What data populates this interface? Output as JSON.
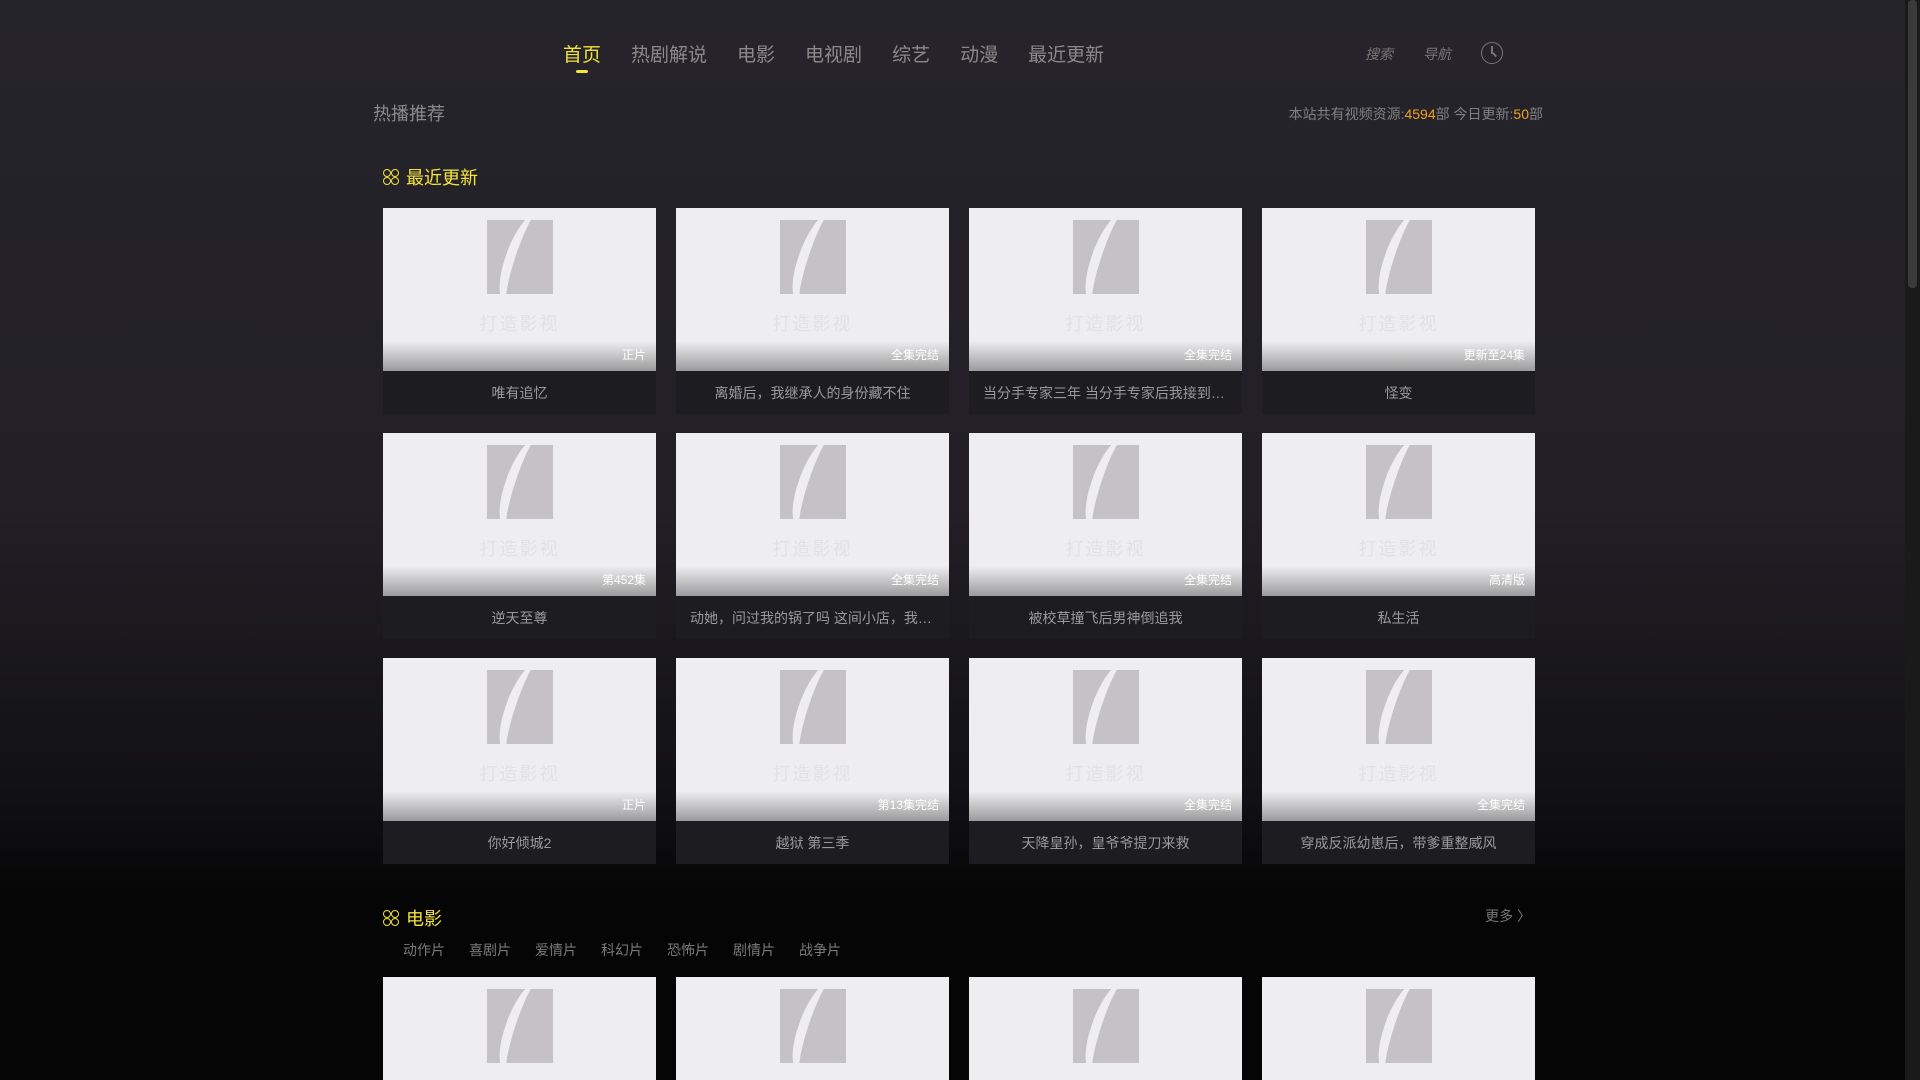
{
  "nav": {
    "items": [
      "首页",
      "热剧解说",
      "电影",
      "电视剧",
      "综艺",
      "动漫",
      "最近更新"
    ],
    "active": 0
  },
  "tools": {
    "search": "搜索",
    "guide": "导航",
    "history_icon": "clock-icon"
  },
  "hot_label": "热播推荐",
  "stats": {
    "prefix": "本站共有视频资源:",
    "total": "4594",
    "unit1": "部 今日更新:",
    "today": "50",
    "unit2": "部"
  },
  "recent": {
    "title": "最近更新",
    "watermark": "打造影视",
    "items": [
      {
        "title": "唯有追忆",
        "badge": "正片"
      },
      {
        "title": "离婚后，我继承人的身份藏不住",
        "badge": "全集完结"
      },
      {
        "title": "当分手专家三年 当分手专家后我接到前任委托",
        "badge": "全集完结"
      },
      {
        "title": "怪变",
        "badge": "更新至24集"
      },
      {
        "title": "逆天至尊",
        "badge": "第452集"
      },
      {
        "title": "动她，问过我的锅了吗 这间小店，我罩了",
        "badge": "全集完结"
      },
      {
        "title": "被校草撞飞后男神倒追我",
        "badge": "全集完结"
      },
      {
        "title": "私生活",
        "badge": "高清版"
      },
      {
        "title": "你好倾城2",
        "badge": "正片"
      },
      {
        "title": "越狱 第三季",
        "badge": "第13集完结"
      },
      {
        "title": "天降皇孙，皇爷爷提刀来救",
        "badge": "全集完结"
      },
      {
        "title": "穿成反派幼崽后，带爹重整威风",
        "badge": "全集完结"
      }
    ]
  },
  "movies": {
    "title": "电影",
    "more": "更多 〉",
    "categories": [
      "动作片",
      "喜剧片",
      "爱情片",
      "科幻片",
      "恐怖片",
      "剧情片",
      "战争片"
    ]
  },
  "colors": {
    "accent": "#f5e33a",
    "number": "#f0a020"
  }
}
